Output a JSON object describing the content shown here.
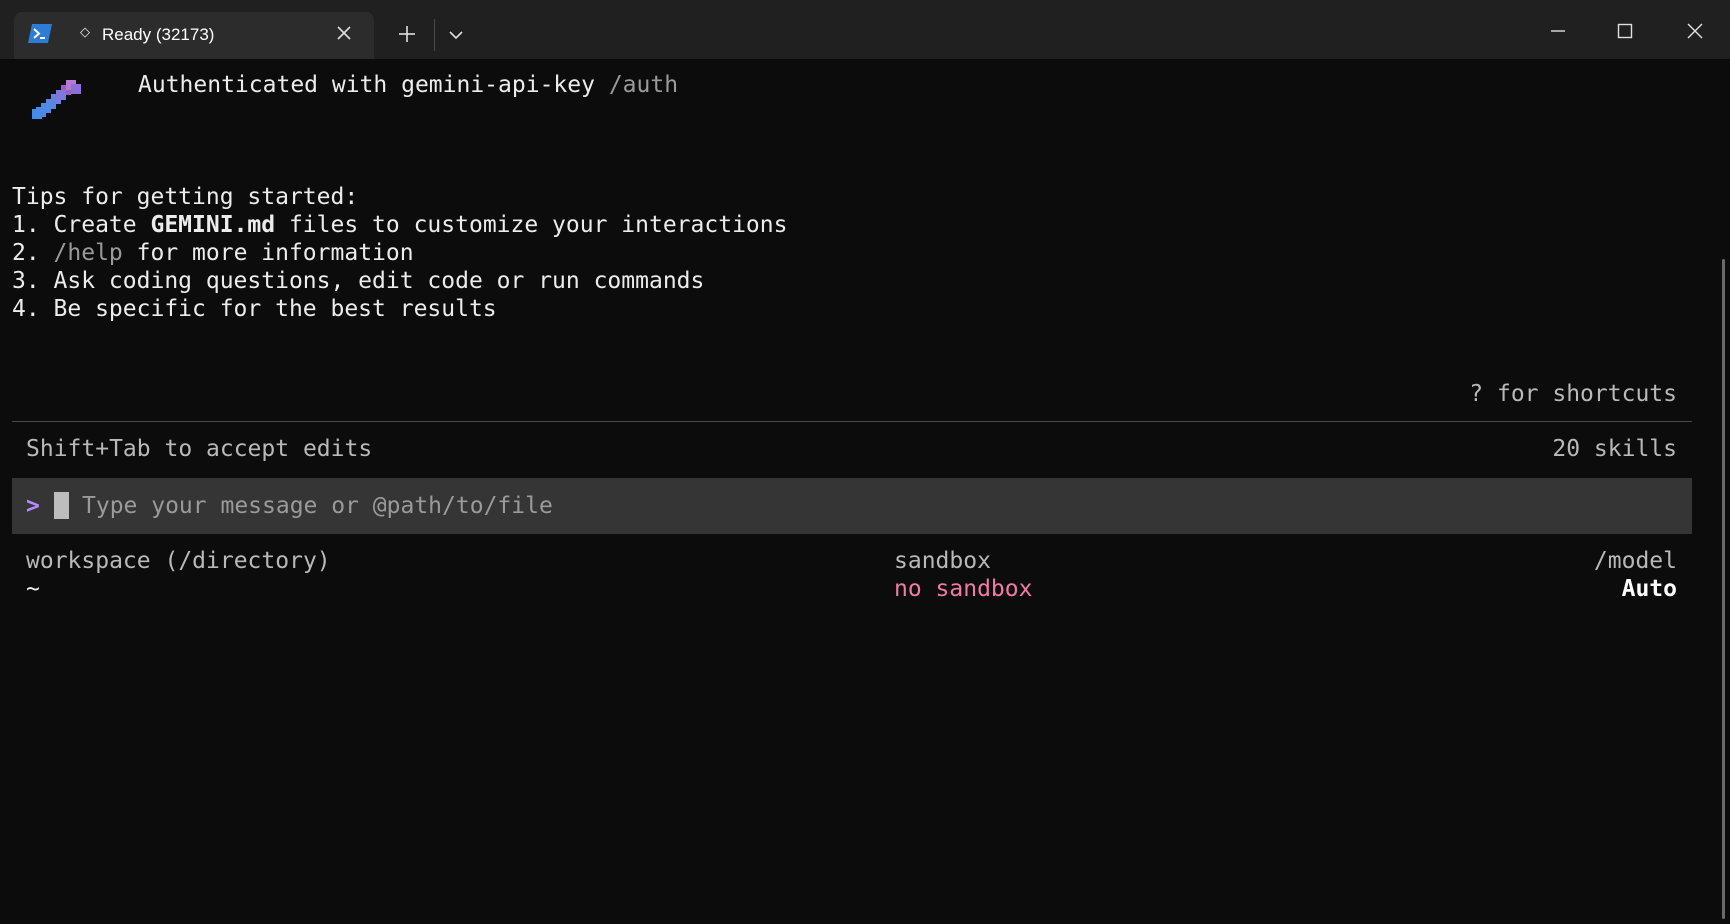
{
  "titlebar": {
    "tab": {
      "icon": "powershell-icon",
      "status_glyph": "◇",
      "title": "Ready (32173)",
      "close_icon": "close-icon"
    },
    "new_tab_icon": "plus-icon",
    "dropdown_icon": "chevron-down-icon",
    "window_controls": [
      "minimize-icon",
      "maximize-icon",
      "close-icon"
    ]
  },
  "header": {
    "logo": "gemini-pixel-logo-icon",
    "auth_text": "Authenticated with gemini-api-key",
    "auth_command": "/auth"
  },
  "tips": {
    "title": "Tips for getting started:",
    "items": [
      {
        "prefix": "1. Create ",
        "bold": "GEMINI.md",
        "suffix": " files to customize your interactions"
      },
      {
        "prefix": "2. ",
        "command": "/help",
        "suffix": " for more information"
      },
      {
        "text": "3. Ask coding questions, edit code or run commands"
      },
      {
        "text": "4. Be specific for the best results"
      }
    ]
  },
  "shortcuts_hint": "? for shortcuts",
  "status_row": {
    "accept_edits": "Shift+Tab to accept edits",
    "skills": "20 skills"
  },
  "input": {
    "prompt": ">",
    "placeholder": "Type your message or @path/to/file",
    "value": ""
  },
  "footer": {
    "workspace_label": "workspace (/directory)",
    "workspace_value": "~",
    "sandbox_label": "sandbox",
    "sandbox_value": "no sandbox",
    "model_label": "/model",
    "model_value": "Auto"
  },
  "colors": {
    "background": "#0c0c0c",
    "titlebar": "#202020",
    "tab": "#2c2c2c",
    "input_bg": "#353535",
    "prompt_accent": "#b38cff",
    "sandbox_warning": "#f27ba6"
  }
}
